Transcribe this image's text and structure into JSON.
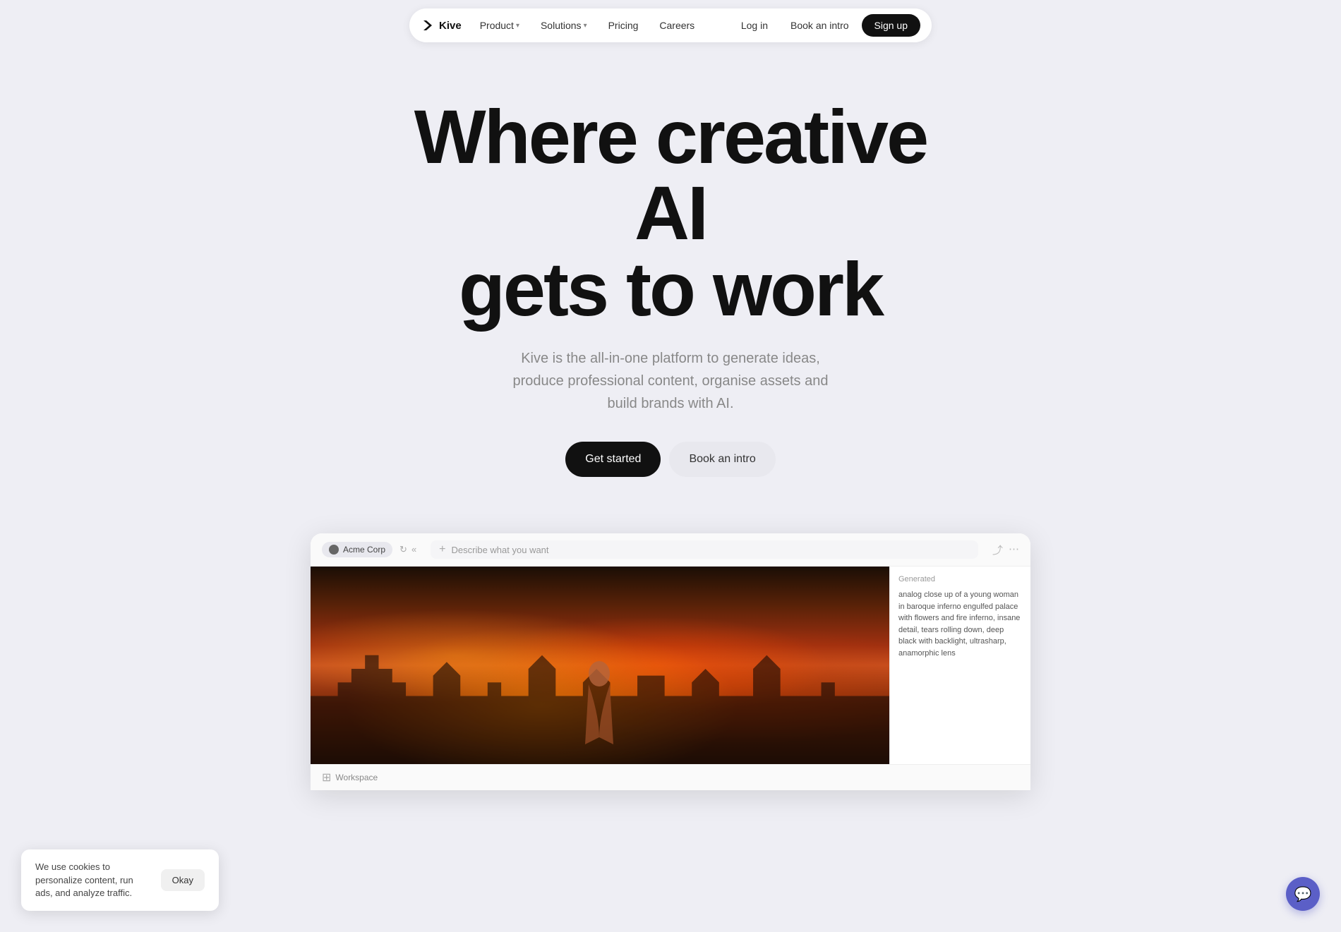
{
  "nav": {
    "logo_text": "Kive",
    "links": [
      {
        "label": "Product",
        "has_dropdown": true
      },
      {
        "label": "Solutions",
        "has_dropdown": true
      },
      {
        "label": "Pricing",
        "has_dropdown": false
      },
      {
        "label": "Careers",
        "has_dropdown": false
      }
    ],
    "actions": {
      "login": "Log in",
      "book_intro": "Book an intro",
      "signup": "Sign up"
    }
  },
  "hero": {
    "title_line1": "Where creative AI",
    "title_line2": "gets to work",
    "subtitle": "Kive is the all-in-one platform to generate ideas, produce professional content, organise assets and build brands with AI.",
    "cta_primary": "Get started",
    "cta_secondary": "Book an intro"
  },
  "demo": {
    "workspace_name": "Acme Corp",
    "prompt_placeholder": "Describe what you want",
    "generated_label": "Generated",
    "generated_text": "analog close up of a young woman in baroque inferno engulfed palace with flowers and fire inferno, insane detail, tears rolling down, deep black with backlight, ultrasharp, anamorphic lens",
    "sidebar_item": "Workspace"
  },
  "cookie": {
    "text": "We use cookies to personalize content, run ads, and analyze traffic.",
    "button": "Okay"
  },
  "chat": {
    "icon": "💬"
  }
}
